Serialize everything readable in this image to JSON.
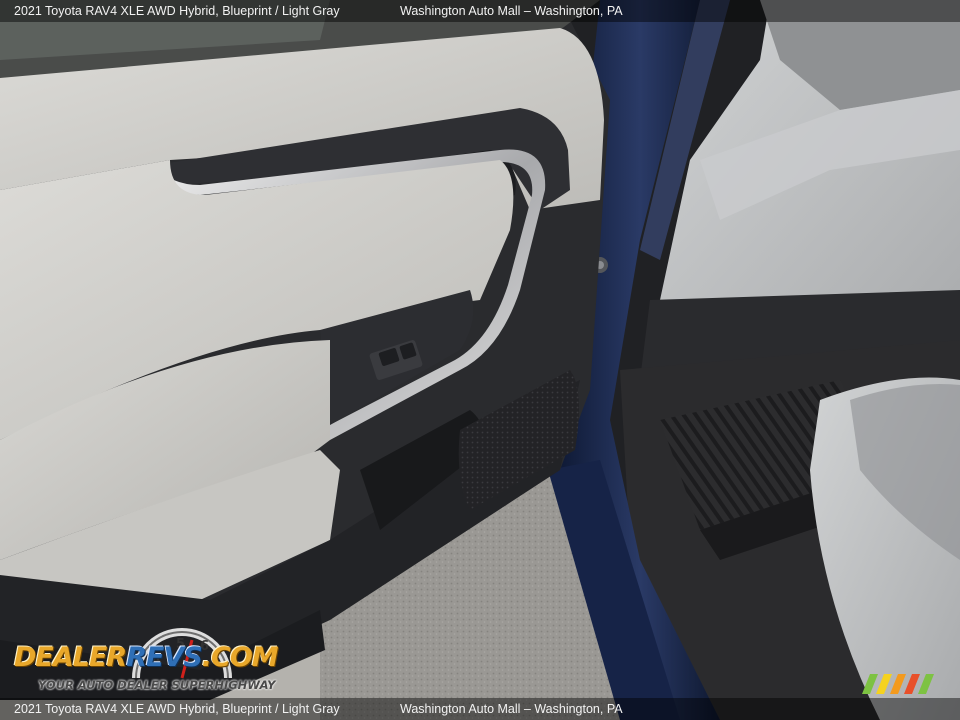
{
  "caption": {
    "vehicle": "2021 Toyota RAV4 XLE AWD Hybrid,  Blueprint / Light Gray",
    "dealer": "Washington Auto Mall – Washington, PA"
  },
  "logo": {
    "word_dealer": "DEALER",
    "word_revs": "REVS",
    "word_com": ".COM",
    "tagline": "YOUR AUTO DEALER SUPERHIGHWAY",
    "gauge_digits": [
      "4",
      "5",
      "6"
    ]
  },
  "colors": {
    "door_panel": "#d4d3cf",
    "door_trim": "#2e2f33",
    "chrome": "#c8c9cc",
    "body_paint": "#1c2a4e",
    "seat_fabric": "#c2c4c6",
    "floor_mat": "#2b2b2d",
    "pavement": "#9a9894",
    "logo_orange": "#e8a72a",
    "logo_blue": "#2f6fb6",
    "stripe_colors": [
      "#7dc242",
      "#f5d21f",
      "#f39a1e",
      "#e8502a",
      "#7dc242"
    ]
  },
  "icons": {
    "door-handle": "door-handle-icon",
    "window-switch": "window-switch-icon",
    "speedometer": "speedometer-icon"
  }
}
